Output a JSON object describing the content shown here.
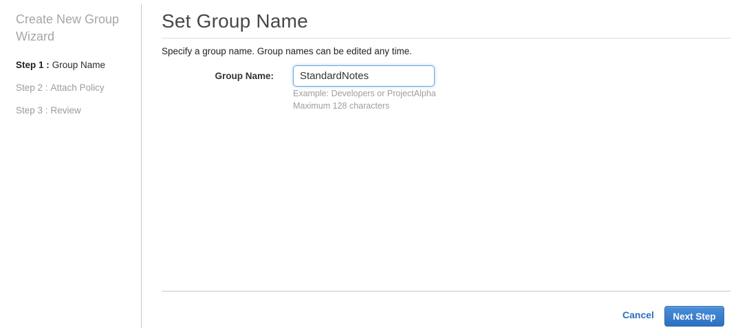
{
  "sidebar": {
    "title": "Create New Group Wizard",
    "steps": [
      {
        "prefix": "Step 1 :",
        "label": "Group Name",
        "active": true
      },
      {
        "prefix": "Step 2 :",
        "label": "Attach Policy",
        "active": false
      },
      {
        "prefix": "Step 3 :",
        "label": "Review",
        "active": false
      }
    ]
  },
  "main": {
    "title": "Set Group Name",
    "description": "Specify a group name. Group names can be edited any time.",
    "form": {
      "group_name_label": "Group Name:",
      "group_name_value": "StandardNotes",
      "help_line1": "Example: Developers or ProjectAlpha",
      "help_line2": "Maximum 128 characters"
    },
    "footer": {
      "cancel_label": "Cancel",
      "next_label": "Next Step"
    }
  },
  "colors": {
    "link_blue": "#2a70bd",
    "btn_top": "#4a8fd8",
    "btn_bottom": "#2d6fc0",
    "btn_border": "#2a68ae",
    "input_border": "#6aa6e2"
  }
}
